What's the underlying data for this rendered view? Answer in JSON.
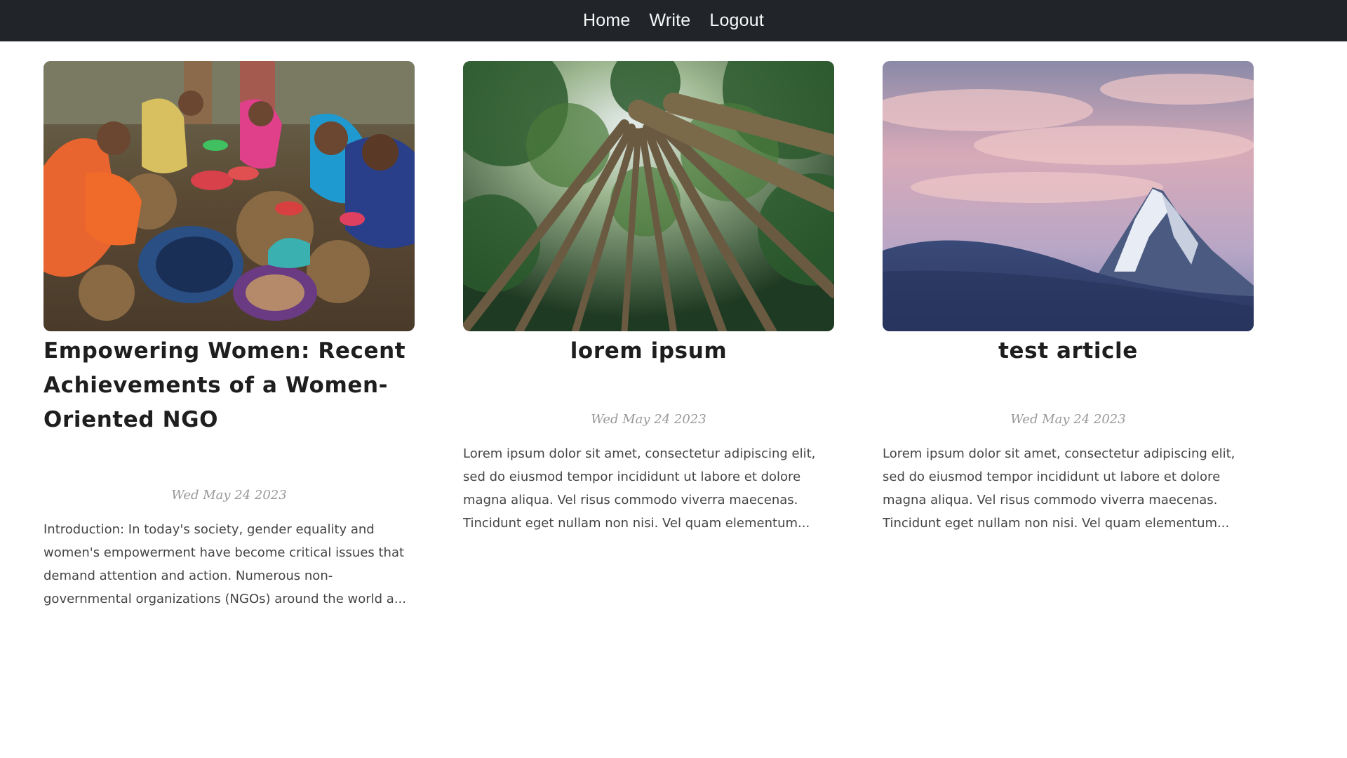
{
  "nav": {
    "items": [
      "Home",
      "Write",
      "Logout"
    ]
  },
  "posts": [
    {
      "title": "Empowering Women: Recent Achievements of a Women-Oriented NGO",
      "date": "Wed May 24 2023",
      "excerpt": "Introduction: In today's society, gender equality and women's empowerment have become critical issues that demand attention and action. Numerous non-governmental organizations (NGOs) around the world a..."
    },
    {
      "title": "lorem ipsum",
      "date": "Wed May 24 2023",
      "excerpt": "Lorem ipsum dolor sit amet, consectetur adipiscing elit, sed do eiusmod tempor incididunt ut labore et dolore magna aliqua. Vel risus commodo viverra maecenas. Tincidunt eget nullam non nisi. Vel quam elementum..."
    },
    {
      "title": "test article",
      "date": "Wed May 24 2023",
      "excerpt": "Lorem ipsum dolor sit amet, consectetur adipiscing elit, sed do eiusmod tempor incididunt ut labore et dolore magna aliqua. Vel risus commodo viverra maecenas. Tincidunt eget nullam non nisi. Vel quam elementum..."
    }
  ],
  "colors": {
    "topbar": "#212529",
    "nav_text": "#f8f9fa",
    "title": "#1e1e1e",
    "date": "#999999",
    "excerpt": "#444444"
  }
}
